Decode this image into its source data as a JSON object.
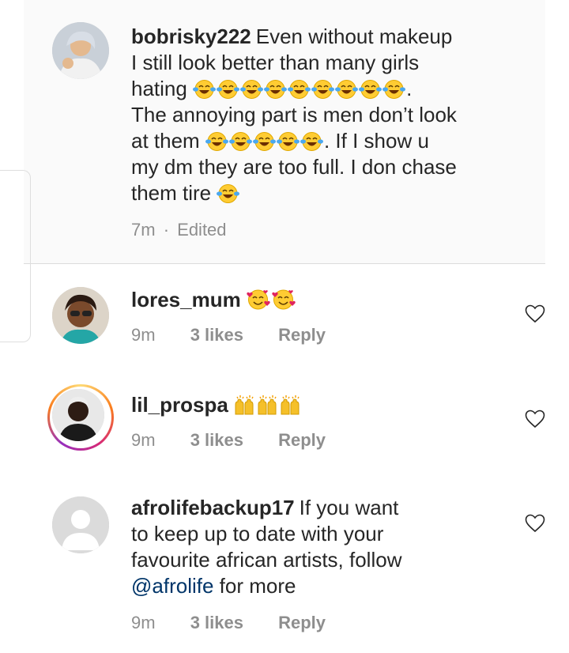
{
  "caption": {
    "username": "bobrisky222",
    "text_lines": [
      "Even without makeup",
      "I still look better than many girls",
      "hating",
      "The annoying part is men don’t look",
      "at them",
      ". If I show u",
      "my dm they are too full. I don chase",
      "them tire"
    ],
    "emoji_tears": "😂",
    "time": "7m",
    "dot": "·",
    "edited": "Edited",
    "period": "."
  },
  "comments": [
    {
      "username": "lores_mum",
      "emoji": "🥰🥰",
      "time": "9m",
      "likes": "3 likes",
      "reply": "Reply"
    },
    {
      "username": "lil_prospa",
      "emoji": "🙌🙌🙌",
      "time": "9m",
      "likes": "3 likes",
      "reply": "Reply"
    },
    {
      "username": "afrolifebackup17",
      "text_lines": [
        "If you want",
        "to keep up to date with your",
        "favourite african artists, follow"
      ],
      "mention": "@afrolife",
      "after_mention": " for more",
      "time": "9m",
      "likes": "3 likes",
      "reply": "Reply"
    }
  ],
  "icons": {
    "like": "heart-outline-icon",
    "emoji_laugh": "tears-of-joy-emoji",
    "emoji_love": "smiling-face-with-hearts-emoji",
    "emoji_raise": "raising-hands-emoji"
  },
  "colors": {
    "text": "#262626",
    "meta": "#8e8e8e",
    "mention": "#003569",
    "caption_bg": "#fafafa"
  }
}
